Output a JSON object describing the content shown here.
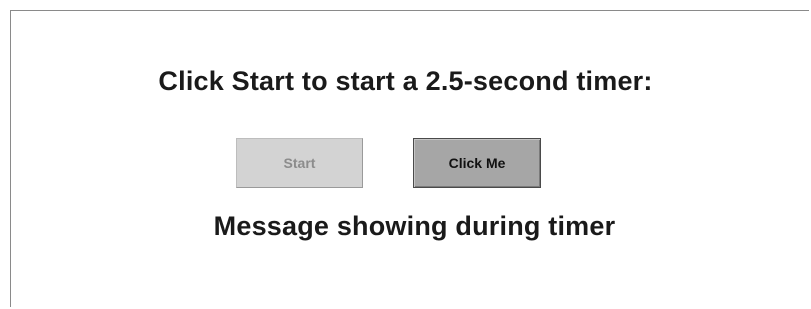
{
  "prompt_text": "Click Start to start a 2.5-second timer:",
  "buttons": {
    "start_label": "Start",
    "start_enabled": false,
    "click_me_label": "Click Me"
  },
  "message_text": "Message showing during timer",
  "colors": {
    "background": "#ffffff",
    "start_button_bg": "#d3d3d3",
    "start_button_text": "#8c8c8c",
    "click_me_button_bg": "#a6a6a6",
    "click_me_button_text": "#111111",
    "text": "#1a1a1a"
  }
}
